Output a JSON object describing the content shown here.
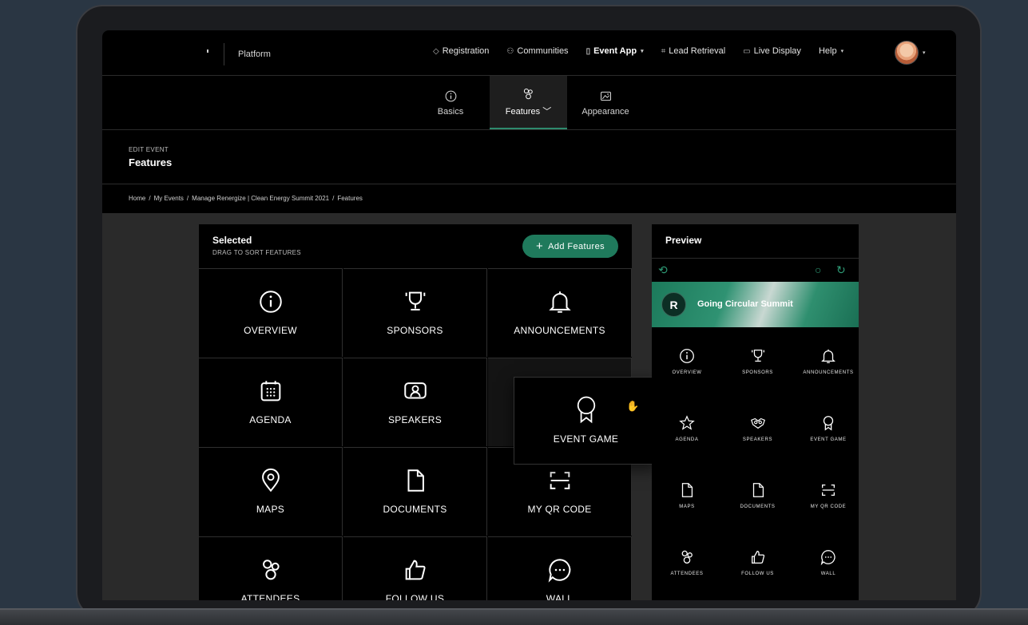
{
  "topnav": {
    "platform": "Platform",
    "links": [
      {
        "icon": "diamond-icon",
        "label": "Registration",
        "active": false,
        "caret": false
      },
      {
        "icon": "people-icon",
        "label": "Communities",
        "active": false,
        "caret": false
      },
      {
        "icon": "phone-icon",
        "label": "Event App",
        "active": true,
        "caret": true
      },
      {
        "icon": "scan-icon",
        "label": "Lead Retrieval",
        "active": false,
        "caret": false
      },
      {
        "icon": "monitor-icon",
        "label": "Live Display",
        "active": false,
        "caret": false
      },
      {
        "icon": "",
        "label": "Help",
        "active": false,
        "caret": true
      }
    ]
  },
  "subnav": {
    "tabs": [
      {
        "label": "Basics",
        "icon": "info-icon"
      },
      {
        "label": "Features",
        "icon": "people-icon",
        "active": true
      },
      {
        "label": "Appearance",
        "icon": "image-icon"
      }
    ]
  },
  "header": {
    "eyebrow": "EDIT EVENT",
    "title": "Features",
    "breadcrumb": [
      "Home",
      "/",
      "My Events",
      "/",
      "Manage Renergize | Clean Energy Summit 2021",
      "/",
      "Features"
    ]
  },
  "selected": {
    "title": "Selected",
    "subtitle": "DRAG TO SORT FEATURES",
    "add_button": "Add Features",
    "features": [
      {
        "label": "OVERVIEW",
        "icon": "info-icon"
      },
      {
        "label": "SPONSORS",
        "icon": "trophy-icon"
      },
      {
        "label": "ANNOUNCEMENTS",
        "icon": "bell-icon"
      },
      {
        "label": "AGENDA",
        "icon": "calendar-icon"
      },
      {
        "label": "SPEAKERS",
        "icon": "speaker-icon"
      },
      {
        "label": "",
        "icon": ""
      },
      {
        "label": "MAPS",
        "icon": "pin-icon"
      },
      {
        "label": "DOCUMENTS",
        "icon": "document-icon"
      },
      {
        "label": "MY QR CODE",
        "icon": "qr-icon"
      },
      {
        "label": "ATTENDEES",
        "icon": "people-icon"
      },
      {
        "label": "FOLLOW US",
        "icon": "thumbs-up-icon"
      },
      {
        "label": "WALL",
        "icon": "chat-icon"
      }
    ],
    "dragging": {
      "label": "EVENT GAME",
      "icon": "award-icon"
    }
  },
  "preview": {
    "title": "Preview",
    "banner_title": "Going Circular Summit",
    "features": [
      {
        "label": "OVERVIEW",
        "icon": "info-icon"
      },
      {
        "label": "SPONSORS",
        "icon": "trophy-icon"
      },
      {
        "label": "ANNOUNCEMENTS",
        "icon": "bell-icon"
      },
      {
        "label": "AGENDA",
        "icon": "star-icon"
      },
      {
        "label": "SPEAKERS",
        "icon": "handshake-icon"
      },
      {
        "label": "EVENT GAME",
        "icon": "award-icon"
      },
      {
        "label": "MAPS",
        "icon": "document-icon"
      },
      {
        "label": "DOCUMENTS",
        "icon": "document-icon"
      },
      {
        "label": "MY QR CODE",
        "icon": "qr-icon"
      },
      {
        "label": "ATTENDEES",
        "icon": "people-icon"
      },
      {
        "label": "FOLLOW US",
        "icon": "thumbs-up-icon"
      },
      {
        "label": "WALL",
        "icon": "chat-icon"
      }
    ]
  },
  "colors": {
    "accent": "#1f7a5c",
    "accent_light": "#2e9b76",
    "panel": "#000000",
    "page_bg": "#2a2a2a"
  }
}
